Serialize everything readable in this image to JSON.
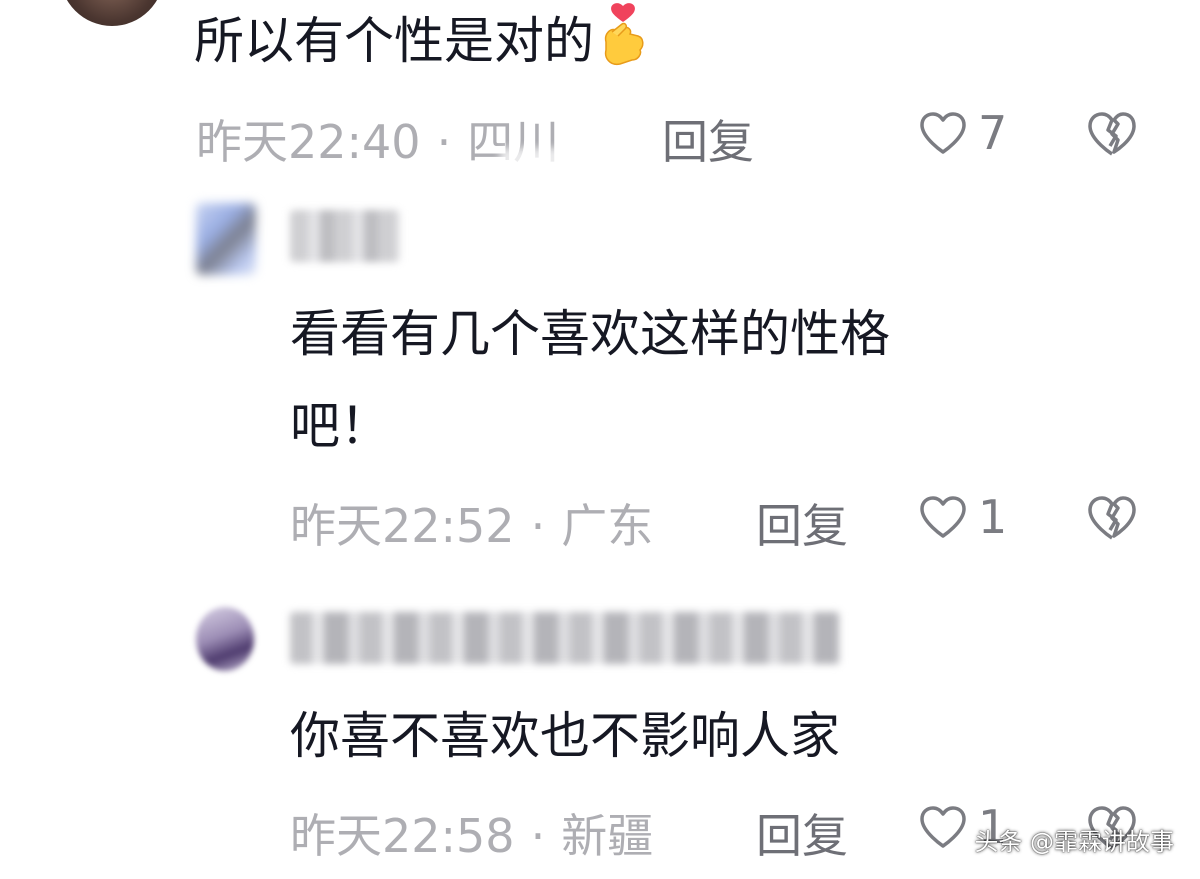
{
  "comments": [
    {
      "text": "所以有个性是对的",
      "emoji": "crossed-fingers-heart",
      "time": "昨天22:40",
      "location": "四川",
      "reply_label": "回复",
      "likes": "7"
    },
    {
      "text_line1": "看看有几个喜欢这样的性格",
      "text_line2": "吧！",
      "time": "昨天22:52",
      "location": "广东",
      "reply_label": "回复",
      "likes": "1"
    },
    {
      "text": "你喜不喜欢也不影响人家",
      "time": "昨天22:58",
      "location": "新疆",
      "reply_label": "回复",
      "likes": "1"
    }
  ],
  "separator": "·",
  "watermark": "头条 @霏霖讲故事",
  "colors": {
    "text": "#161823",
    "meta": "#aeaeb3",
    "reply": "#6e6f76",
    "icon": "#7b7c82"
  }
}
